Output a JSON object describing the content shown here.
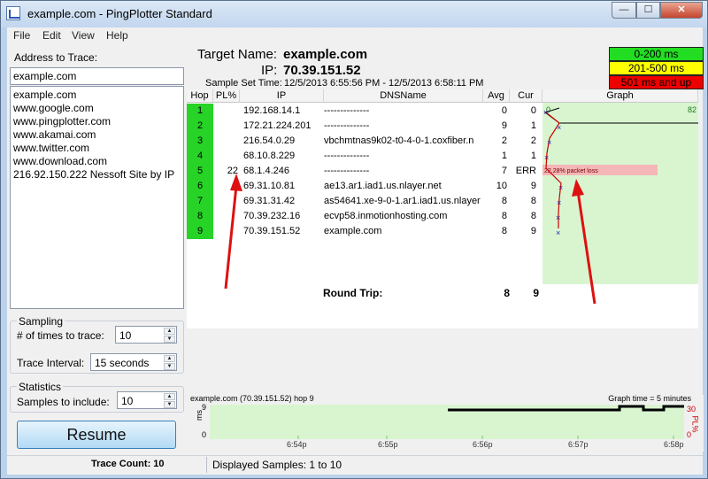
{
  "window": {
    "title": "example.com - PingPlotter Standard",
    "buttons": {
      "minimize": "—",
      "maximize": "☐",
      "close": "✕"
    }
  },
  "menu": [
    "File",
    "Edit",
    "View",
    "Help"
  ],
  "left": {
    "address_label": "Address to Trace:",
    "address_value": "example.com",
    "address_list": [
      "example.com",
      "www.google.com",
      "www.pingplotter.com",
      "www.akamai.com",
      "www.twitter.com",
      "www.download.com",
      "216.92.150.222 Nessoft Site by IP"
    ],
    "sampling": {
      "title": "Sampling",
      "times_label": "# of times to trace:",
      "times_value": "10",
      "interval_label": "Trace Interval:",
      "interval_value": "15 seconds"
    },
    "statistics": {
      "title": "Statistics",
      "samples_label": "Samples to include:",
      "samples_value": "10"
    },
    "resume_label": "Resume"
  },
  "header": {
    "target_name_label": "Target Name:",
    "target_name": "example.com",
    "ip_label": "IP:",
    "ip": "70.39.151.52",
    "sample_set_label": "Sample Set Time:",
    "sample_set_value": "12/5/2013 6:55:56 PM - 12/5/2013 6:58:11 PM"
  },
  "legend": [
    {
      "label": "0-200 ms",
      "color": "#22dd22",
      "text_color": "#000000"
    },
    {
      "label": "201-500 ms",
      "color": "#ffff00",
      "text_color": "#000000"
    },
    {
      "label": "501 ms and up",
      "color": "#ee0000",
      "text_color": "#000000"
    }
  ],
  "table": {
    "columns": [
      "Hop",
      "PL%",
      "IP",
      "DNSName",
      "Avg",
      "Cur",
      "Graph"
    ],
    "rows": [
      {
        "hop": "1",
        "pl": "",
        "ip": "192.168.14.1",
        "dns": "--------------",
        "avg": "0",
        "cur": "0"
      },
      {
        "hop": "2",
        "pl": "",
        "ip": "172.21.224.201",
        "dns": "--------------",
        "avg": "9",
        "cur": "1"
      },
      {
        "hop": "3",
        "pl": "",
        "ip": "216.54.0.29",
        "dns": "vbchmtnas9k02-t0-4-0-1.coxfiber.n",
        "avg": "2",
        "cur": "2"
      },
      {
        "hop": "4",
        "pl": "",
        "ip": "68.10.8.229",
        "dns": "--------------",
        "avg": "1",
        "cur": "1"
      },
      {
        "hop": "5",
        "pl": "22",
        "ip": "68.1.4.246",
        "dns": "--------------",
        "avg": "7",
        "cur": "ERR"
      },
      {
        "hop": "6",
        "pl": "",
        "ip": "69.31.10.81",
        "dns": "ae13.ar1.iad1.us.nlayer.net",
        "avg": "10",
        "cur": "9"
      },
      {
        "hop": "7",
        "pl": "",
        "ip": "69.31.31.42",
        "dns": "as54641.xe-9-0-1.ar1.iad1.us.nlayer",
        "avg": "8",
        "cur": "8"
      },
      {
        "hop": "8",
        "pl": "",
        "ip": "70.39.232.16",
        "dns": "ecvp58.inmotionhosting.com",
        "avg": "8",
        "cur": "8"
      },
      {
        "hop": "9",
        "pl": "",
        "ip": "70.39.151.52",
        "dns": "example.com",
        "avg": "8",
        "cur": "9"
      }
    ],
    "round_trip_label": "Round Trip:",
    "round_trip_avg": "8",
    "round_trip_cur": "9",
    "graph": {
      "scale_min": "0",
      "scale_max": "82",
      "packet_loss_label": "22.28% packet loss",
      "packet_loss_color": "#f4b6b6"
    }
  },
  "time_graph": {
    "title": "example.com (70.39.151.52) hop 9",
    "graph_time": "Graph time = 5 minutes",
    "y_left": [
      "9",
      "0"
    ],
    "y_left_unit": "ms",
    "y_right": [
      "30",
      "0"
    ],
    "y_right_unit": "PL%",
    "x_labels": [
      "6:54p",
      "6:55p",
      "6:56p",
      "6:57p",
      "6:58p"
    ]
  },
  "status": {
    "trace_count": "Trace Count: 10",
    "displayed_samples": "Displayed Samples: 1 to 10"
  }
}
